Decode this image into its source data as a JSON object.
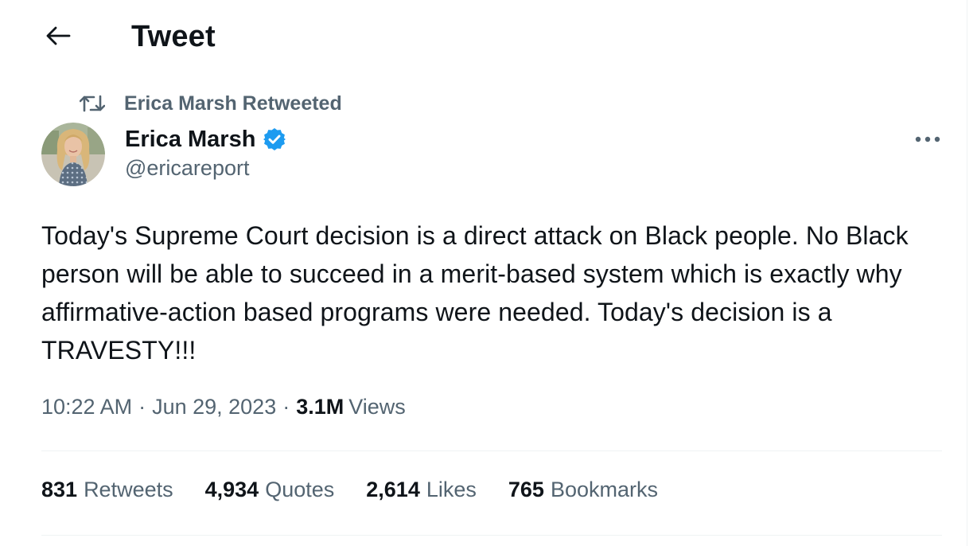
{
  "header": {
    "title": "Tweet"
  },
  "retweet": {
    "label": "Erica Marsh Retweeted"
  },
  "author": {
    "name": "Erica Marsh",
    "handle": "@ericareport"
  },
  "tweet": {
    "text": "Today's Supreme Court decision is a direct attack on Black people. No Black person will be able to succeed in a merit-based system which is exactly why affirmative-action based programs were needed. Today's decision is a TRAVESTY!!!",
    "time": "10:22 AM",
    "date": "Jun 29, 2023",
    "separator": "·",
    "views_count": "3.1M",
    "views_label": "Views"
  },
  "stats": [
    {
      "count": "831",
      "label": "Retweets"
    },
    {
      "count": "4,934",
      "label": "Quotes"
    },
    {
      "count": "2,614",
      "label": "Likes"
    },
    {
      "count": "765",
      "label": "Bookmarks"
    }
  ],
  "colors": {
    "text_primary": "#0f1419",
    "text_secondary": "#536471",
    "verified_blue": "#1d9bf0",
    "divider": "#eff3f4"
  },
  "icons": {
    "back": "arrow-left-icon",
    "retweet": "retweet-icon",
    "verified": "verified-badge-icon",
    "more": "more-horizontal-icon"
  }
}
